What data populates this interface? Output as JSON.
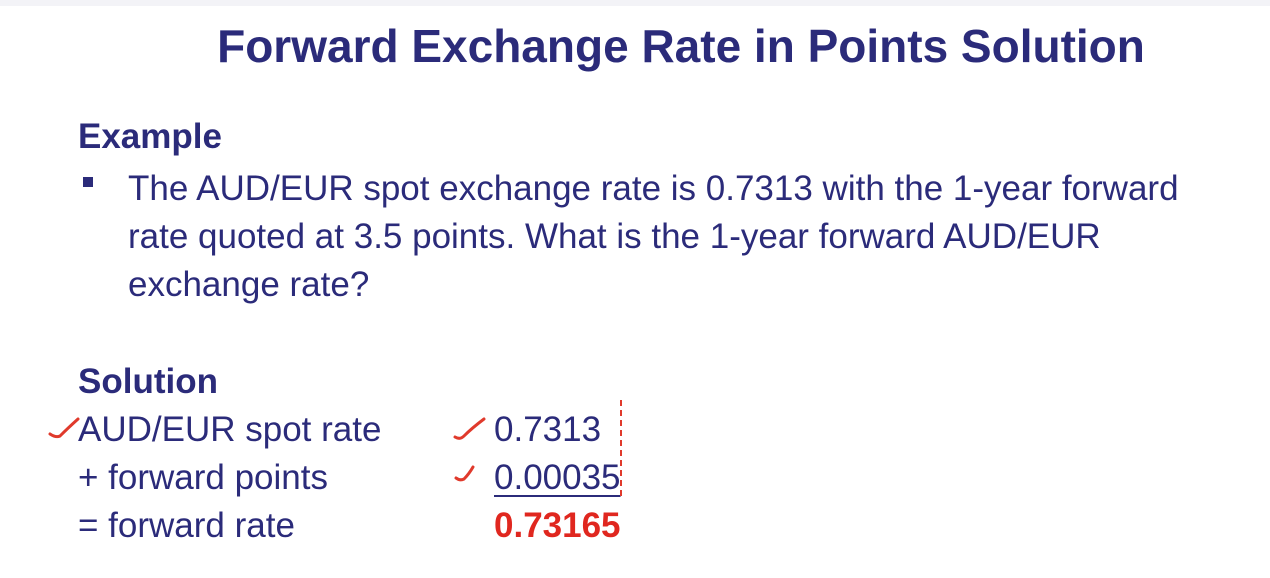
{
  "slide": {
    "title": "Forward Exchange Rate in Points Solution"
  },
  "example": {
    "heading": "Example",
    "bullet": "The AUD/EUR spot exchange rate is 0.7313 with the 1-year forward rate quoted at 3.5 points. What is the 1-year forward AUD/EUR exchange rate?"
  },
  "solution": {
    "heading": "Solution",
    "rows": [
      {
        "label": "AUD/EUR spot rate",
        "value": "0.7313"
      },
      {
        "label": "+ forward points",
        "value": "0.00035"
      },
      {
        "label": "= forward rate",
        "value": "0.73165"
      }
    ]
  },
  "colors": {
    "text": "#2b2b7a",
    "result": "#e0271f",
    "annotation": "#e03a2c"
  }
}
